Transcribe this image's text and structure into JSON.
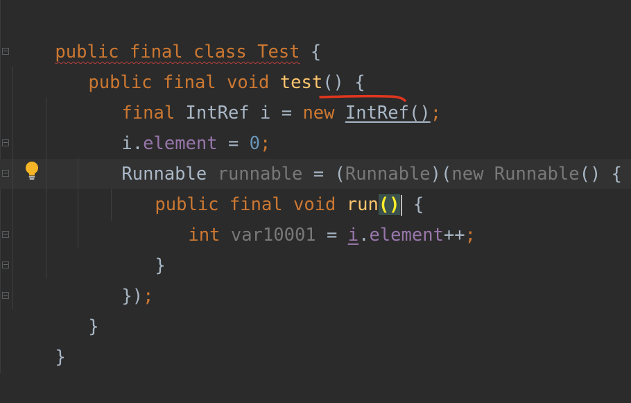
{
  "code": {
    "l1": {
      "t1": "public final class Test",
      "t2": " {"
    },
    "l2": {
      "t1": "public final void ",
      "t2": "test",
      "t3": "() {"
    },
    "l3": {
      "t1": "final ",
      "t2": "IntRef i = ",
      "t3": "new ",
      "t4": "IntRef()",
      "t5": ";"
    },
    "l4": {
      "t1": "i.",
      "t2": "element",
      "t3": " = ",
      "t4": "0",
      "t5": ";"
    },
    "l5": {
      "t1": "Runnable ",
      "t2": "runnable",
      "t3": " = (",
      "t4": "Runnable",
      "t5": ")(",
      "t6": "new Runnable",
      "t7": "() {"
    },
    "l6": {
      "t1": "public final void ",
      "t2": "run",
      "t3": "()",
      "t4": " {"
    },
    "l7": {
      "t1": "int ",
      "t2": "var10001",
      "t3": " = ",
      "t4": "i",
      "t5": ".",
      "t6": "element",
      "t7": "++",
      "t8": ";"
    },
    "l8": {
      "t1": "}"
    },
    "l9": {
      "t1": "})",
      "t2": ";"
    },
    "l10": {
      "t1": "}"
    },
    "l11": {
      "t1": "}"
    }
  },
  "icons": {
    "bulb": "intention-bulb-icon",
    "fold": "fold-marker-icon"
  },
  "colors": {
    "background": "#2b2b2b",
    "keyword": "#cc7832",
    "function": "#ffc66d",
    "number": "#6897bb",
    "field": "#9876aa",
    "text": "#a9b7c6",
    "unused": "#787878",
    "bulb": "#f5b526",
    "annotation_red": "#e0361f"
  }
}
